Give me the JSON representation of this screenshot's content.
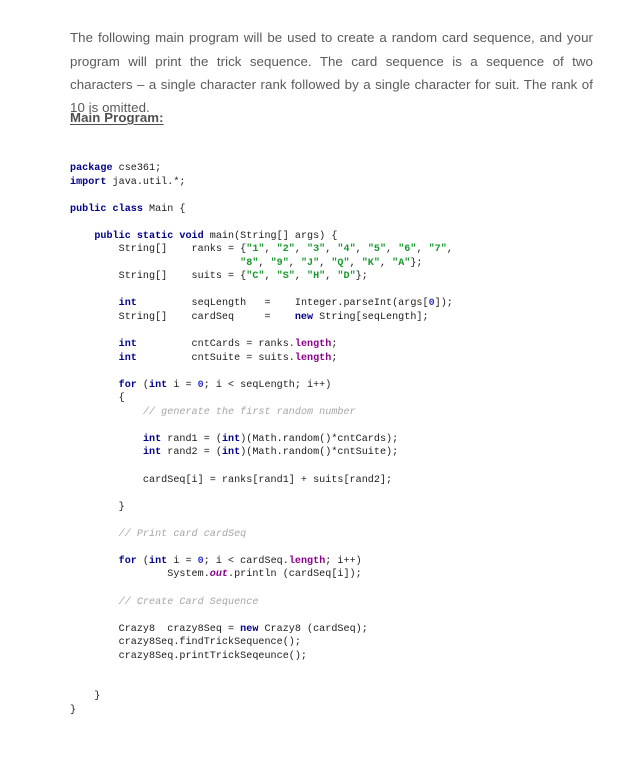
{
  "document": {
    "intro_paragraph": "The following main program will be used to create a random card sequence, and your program will print the trick sequence. The card sequence is a sequence of two characters – a single character rank followed by a single character for suit.  The rank of 10 is omitted.",
    "section_heading": "Main Program:"
  },
  "colors": {
    "body_text": "#5a5a5a",
    "heading_text": "#4f4f4f",
    "code_plain": "#1b1b1b",
    "keyword": "#00008b",
    "string_literal": "#1a9a2e",
    "number_literal": "#3333cc",
    "field_member": "#8b008b",
    "comment": "#a6a6a6",
    "page_background": "#ffffff"
  },
  "code": {
    "language": "java",
    "lines": [
      [
        {
          "t": "package",
          "c": "kw"
        },
        {
          "t": " cse361;",
          "c": "pln"
        }
      ],
      [
        {
          "t": "import",
          "c": "kw"
        },
        {
          "t": " java.util.*;",
          "c": "pln"
        }
      ],
      [],
      [
        {
          "t": "public class",
          "c": "kw"
        },
        {
          "t": " Main {",
          "c": "pln"
        }
      ],
      [],
      [
        {
          "t": "    ",
          "c": "pln"
        },
        {
          "t": "public static void",
          "c": "kw"
        },
        {
          "t": " main(String[] args) {",
          "c": "pln"
        }
      ],
      [
        {
          "t": "        String[]    ranks = {",
          "c": "pln"
        },
        {
          "t": "\"1\"",
          "c": "str"
        },
        {
          "t": ", ",
          "c": "pln"
        },
        {
          "t": "\"2\"",
          "c": "str"
        },
        {
          "t": ", ",
          "c": "pln"
        },
        {
          "t": "\"3\"",
          "c": "str"
        },
        {
          "t": ", ",
          "c": "pln"
        },
        {
          "t": "\"4\"",
          "c": "str"
        },
        {
          "t": ", ",
          "c": "pln"
        },
        {
          "t": "\"5\"",
          "c": "str"
        },
        {
          "t": ", ",
          "c": "pln"
        },
        {
          "t": "\"6\"",
          "c": "str"
        },
        {
          "t": ", ",
          "c": "pln"
        },
        {
          "t": "\"7\"",
          "c": "str"
        },
        {
          "t": ",",
          "c": "pln"
        }
      ],
      [
        {
          "t": "                            ",
          "c": "pln"
        },
        {
          "t": "\"8\"",
          "c": "str"
        },
        {
          "t": ", ",
          "c": "pln"
        },
        {
          "t": "\"9\"",
          "c": "str"
        },
        {
          "t": ", ",
          "c": "pln"
        },
        {
          "t": "\"J\"",
          "c": "str"
        },
        {
          "t": ", ",
          "c": "pln"
        },
        {
          "t": "\"Q\"",
          "c": "str"
        },
        {
          "t": ", ",
          "c": "pln"
        },
        {
          "t": "\"K\"",
          "c": "str"
        },
        {
          "t": ", ",
          "c": "pln"
        },
        {
          "t": "\"A\"",
          "c": "str"
        },
        {
          "t": "};",
          "c": "pln"
        }
      ],
      [
        {
          "t": "        String[]    suits = {",
          "c": "pln"
        },
        {
          "t": "\"C\"",
          "c": "str"
        },
        {
          "t": ", ",
          "c": "pln"
        },
        {
          "t": "\"S\"",
          "c": "str"
        },
        {
          "t": ", ",
          "c": "pln"
        },
        {
          "t": "\"H\"",
          "c": "str"
        },
        {
          "t": ", ",
          "c": "pln"
        },
        {
          "t": "\"D\"",
          "c": "str"
        },
        {
          "t": "};",
          "c": "pln"
        }
      ],
      [],
      [
        {
          "t": "        ",
          "c": "pln"
        },
        {
          "t": "int",
          "c": "kw"
        },
        {
          "t": "         seqLength   =    Integer.parseInt(args[",
          "c": "pln"
        },
        {
          "t": "0",
          "c": "num"
        },
        {
          "t": "]);",
          "c": "pln"
        }
      ],
      [
        {
          "t": "        String[]    cardSeq     =    ",
          "c": "pln"
        },
        {
          "t": "new",
          "c": "kw"
        },
        {
          "t": " String[seqLength];",
          "c": "pln"
        }
      ],
      [],
      [
        {
          "t": "        ",
          "c": "pln"
        },
        {
          "t": "int",
          "c": "kw"
        },
        {
          "t": "         cntCards = ranks.",
          "c": "pln"
        },
        {
          "t": "length",
          "c": "fld"
        },
        {
          "t": ";",
          "c": "pln"
        }
      ],
      [
        {
          "t": "        ",
          "c": "pln"
        },
        {
          "t": "int",
          "c": "kw"
        },
        {
          "t": "         cntSuite = suits.",
          "c": "pln"
        },
        {
          "t": "length",
          "c": "fld"
        },
        {
          "t": ";",
          "c": "pln"
        }
      ],
      [],
      [
        {
          "t": "        ",
          "c": "pln"
        },
        {
          "t": "for",
          "c": "kw"
        },
        {
          "t": " (",
          "c": "pln"
        },
        {
          "t": "int",
          "c": "kw"
        },
        {
          "t": " i = ",
          "c": "pln"
        },
        {
          "t": "0",
          "c": "num"
        },
        {
          "t": "; i < seqLength; i++)",
          "c": "pln"
        }
      ],
      [
        {
          "t": "        {",
          "c": "pln"
        }
      ],
      [
        {
          "t": "            ",
          "c": "pln"
        },
        {
          "t": "// generate the first random number",
          "c": "cmt"
        }
      ],
      [],
      [
        {
          "t": "            ",
          "c": "pln"
        },
        {
          "t": "int",
          "c": "kw"
        },
        {
          "t": " rand1 = (",
          "c": "pln"
        },
        {
          "t": "int",
          "c": "kw"
        },
        {
          "t": ")(Math.random()*cntCards);",
          "c": "pln"
        }
      ],
      [
        {
          "t": "            ",
          "c": "pln"
        },
        {
          "t": "int",
          "c": "kw"
        },
        {
          "t": " rand2 = (",
          "c": "pln"
        },
        {
          "t": "int",
          "c": "kw"
        },
        {
          "t": ")(Math.random()*cntSuite);",
          "c": "pln"
        }
      ],
      [],
      [
        {
          "t": "            cardSeq[i] = ranks[rand1] + suits[rand2];",
          "c": "pln"
        }
      ],
      [],
      [
        {
          "t": "        }",
          "c": "pln"
        }
      ],
      [],
      [
        {
          "t": "        ",
          "c": "pln"
        },
        {
          "t": "// Print card cardSeq",
          "c": "cmt"
        }
      ],
      [],
      [
        {
          "t": "        ",
          "c": "pln"
        },
        {
          "t": "for",
          "c": "kw"
        },
        {
          "t": " (",
          "c": "pln"
        },
        {
          "t": "int",
          "c": "kw"
        },
        {
          "t": " i = ",
          "c": "pln"
        },
        {
          "t": "0",
          "c": "num"
        },
        {
          "t": "; i < cardSeq.",
          "c": "pln"
        },
        {
          "t": "length",
          "c": "fld"
        },
        {
          "t": "; i++)",
          "c": "pln"
        }
      ],
      [
        {
          "t": "                System.",
          "c": "pln"
        },
        {
          "t": "out",
          "c": "fldi"
        },
        {
          "t": ".println (cardSeq[i]);",
          "c": "pln"
        }
      ],
      [],
      [
        {
          "t": "        ",
          "c": "pln"
        },
        {
          "t": "// Create Card Sequence",
          "c": "cmt"
        }
      ],
      [],
      [
        {
          "t": "        Crazy8  crazy8Seq = ",
          "c": "pln"
        },
        {
          "t": "new",
          "c": "kw"
        },
        {
          "t": " Crazy8 (cardSeq);",
          "c": "pln"
        }
      ],
      [
        {
          "t": "        crazy8Seq.findTrickSequence();",
          "c": "pln"
        }
      ],
      [
        {
          "t": "        crazy8Seq.printTrickSeqeunce();",
          "c": "pln"
        }
      ],
      [],
      [],
      [
        {
          "t": "    }",
          "c": "pln"
        }
      ],
      [
        {
          "t": "}",
          "c": "pln"
        }
      ]
    ]
  }
}
